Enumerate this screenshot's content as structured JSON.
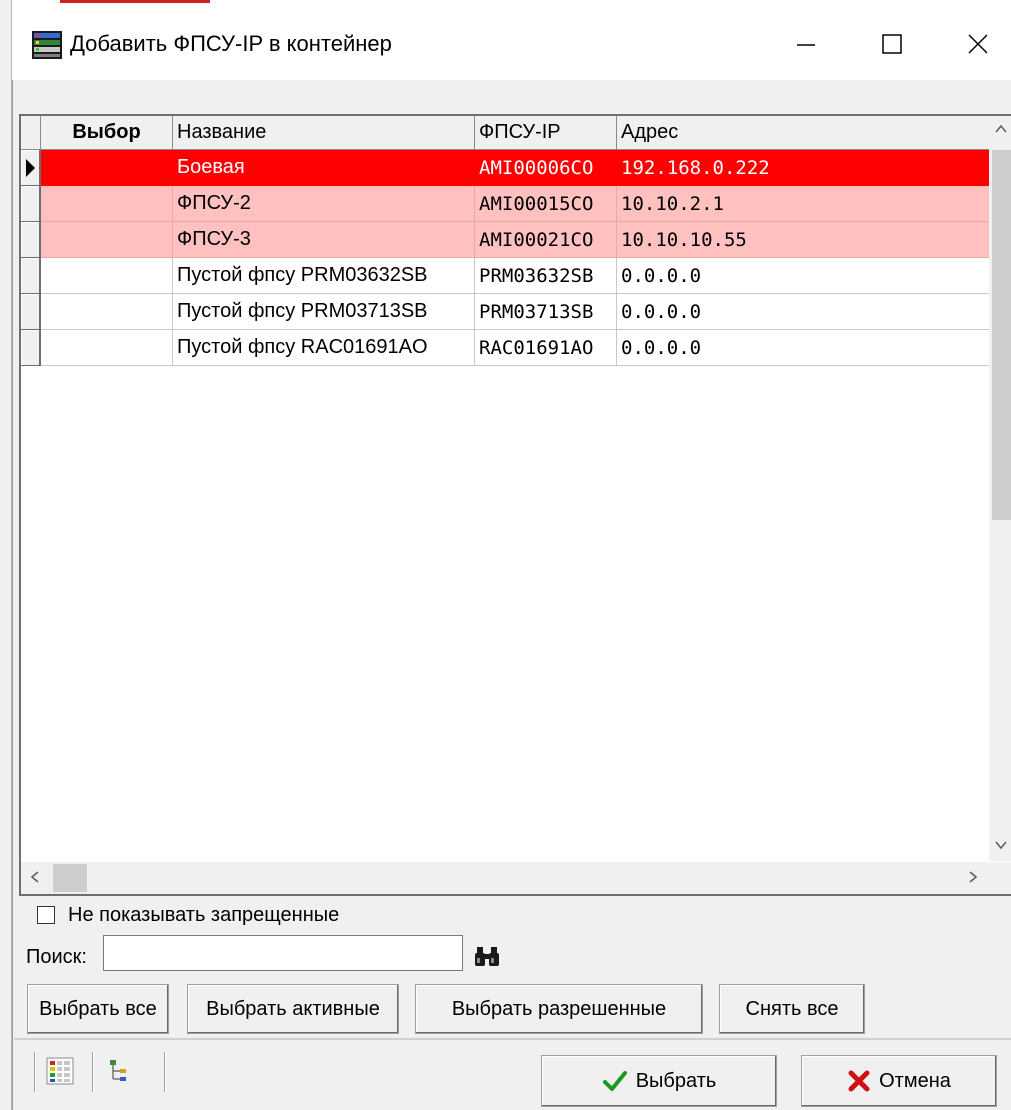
{
  "window": {
    "title": "Добавить ФПСУ-IP в контейнер"
  },
  "grid": {
    "columns": [
      "Выбор",
      "Название",
      "ФПСУ-IP",
      "Адрес"
    ],
    "rows": [
      {
        "name": "Боевая",
        "fpsu": "AMI00006CO",
        "address": "192.168.0.222",
        "style": "red",
        "current": true
      },
      {
        "name": "ФПСУ-2",
        "fpsu": "AMI00015CO",
        "address": "10.10.2.1",
        "style": "pink",
        "current": false
      },
      {
        "name": "ФПСУ-3",
        "fpsu": "AMI00021CO",
        "address": "10.10.10.55",
        "style": "pink",
        "current": false
      },
      {
        "name": "Пустой фпсу PRM03632SB",
        "fpsu": "PRM03632SB",
        "address": "0.0.0.0",
        "style": "normal",
        "current": false
      },
      {
        "name": "Пустой фпсу PRM03713SB",
        "fpsu": "PRM03713SB",
        "address": "0.0.0.0",
        "style": "normal",
        "current": false
      },
      {
        "name": "Пустой фпсу RAC01691AO",
        "fpsu": "RAC01691AO",
        "address": "0.0.0.0",
        "style": "normal",
        "current": false
      }
    ]
  },
  "filter": {
    "hide_forbidden_label": "Не показывать запрещенные",
    "hide_forbidden_checked": false,
    "search_label": "Поиск:",
    "search_value": ""
  },
  "buttons": {
    "select_all": "Выбрать все",
    "select_active": "Выбрать активные",
    "select_allowed": "Выбрать разрешенные",
    "clear_all": "Снять все",
    "ok": "Выбрать",
    "cancel": "Отмена"
  },
  "colors": {
    "current_row": "#ff0000",
    "highlight_row": "#ffc0c0",
    "ok_check": "#1a9a1a",
    "cancel_x": "#d01010"
  }
}
